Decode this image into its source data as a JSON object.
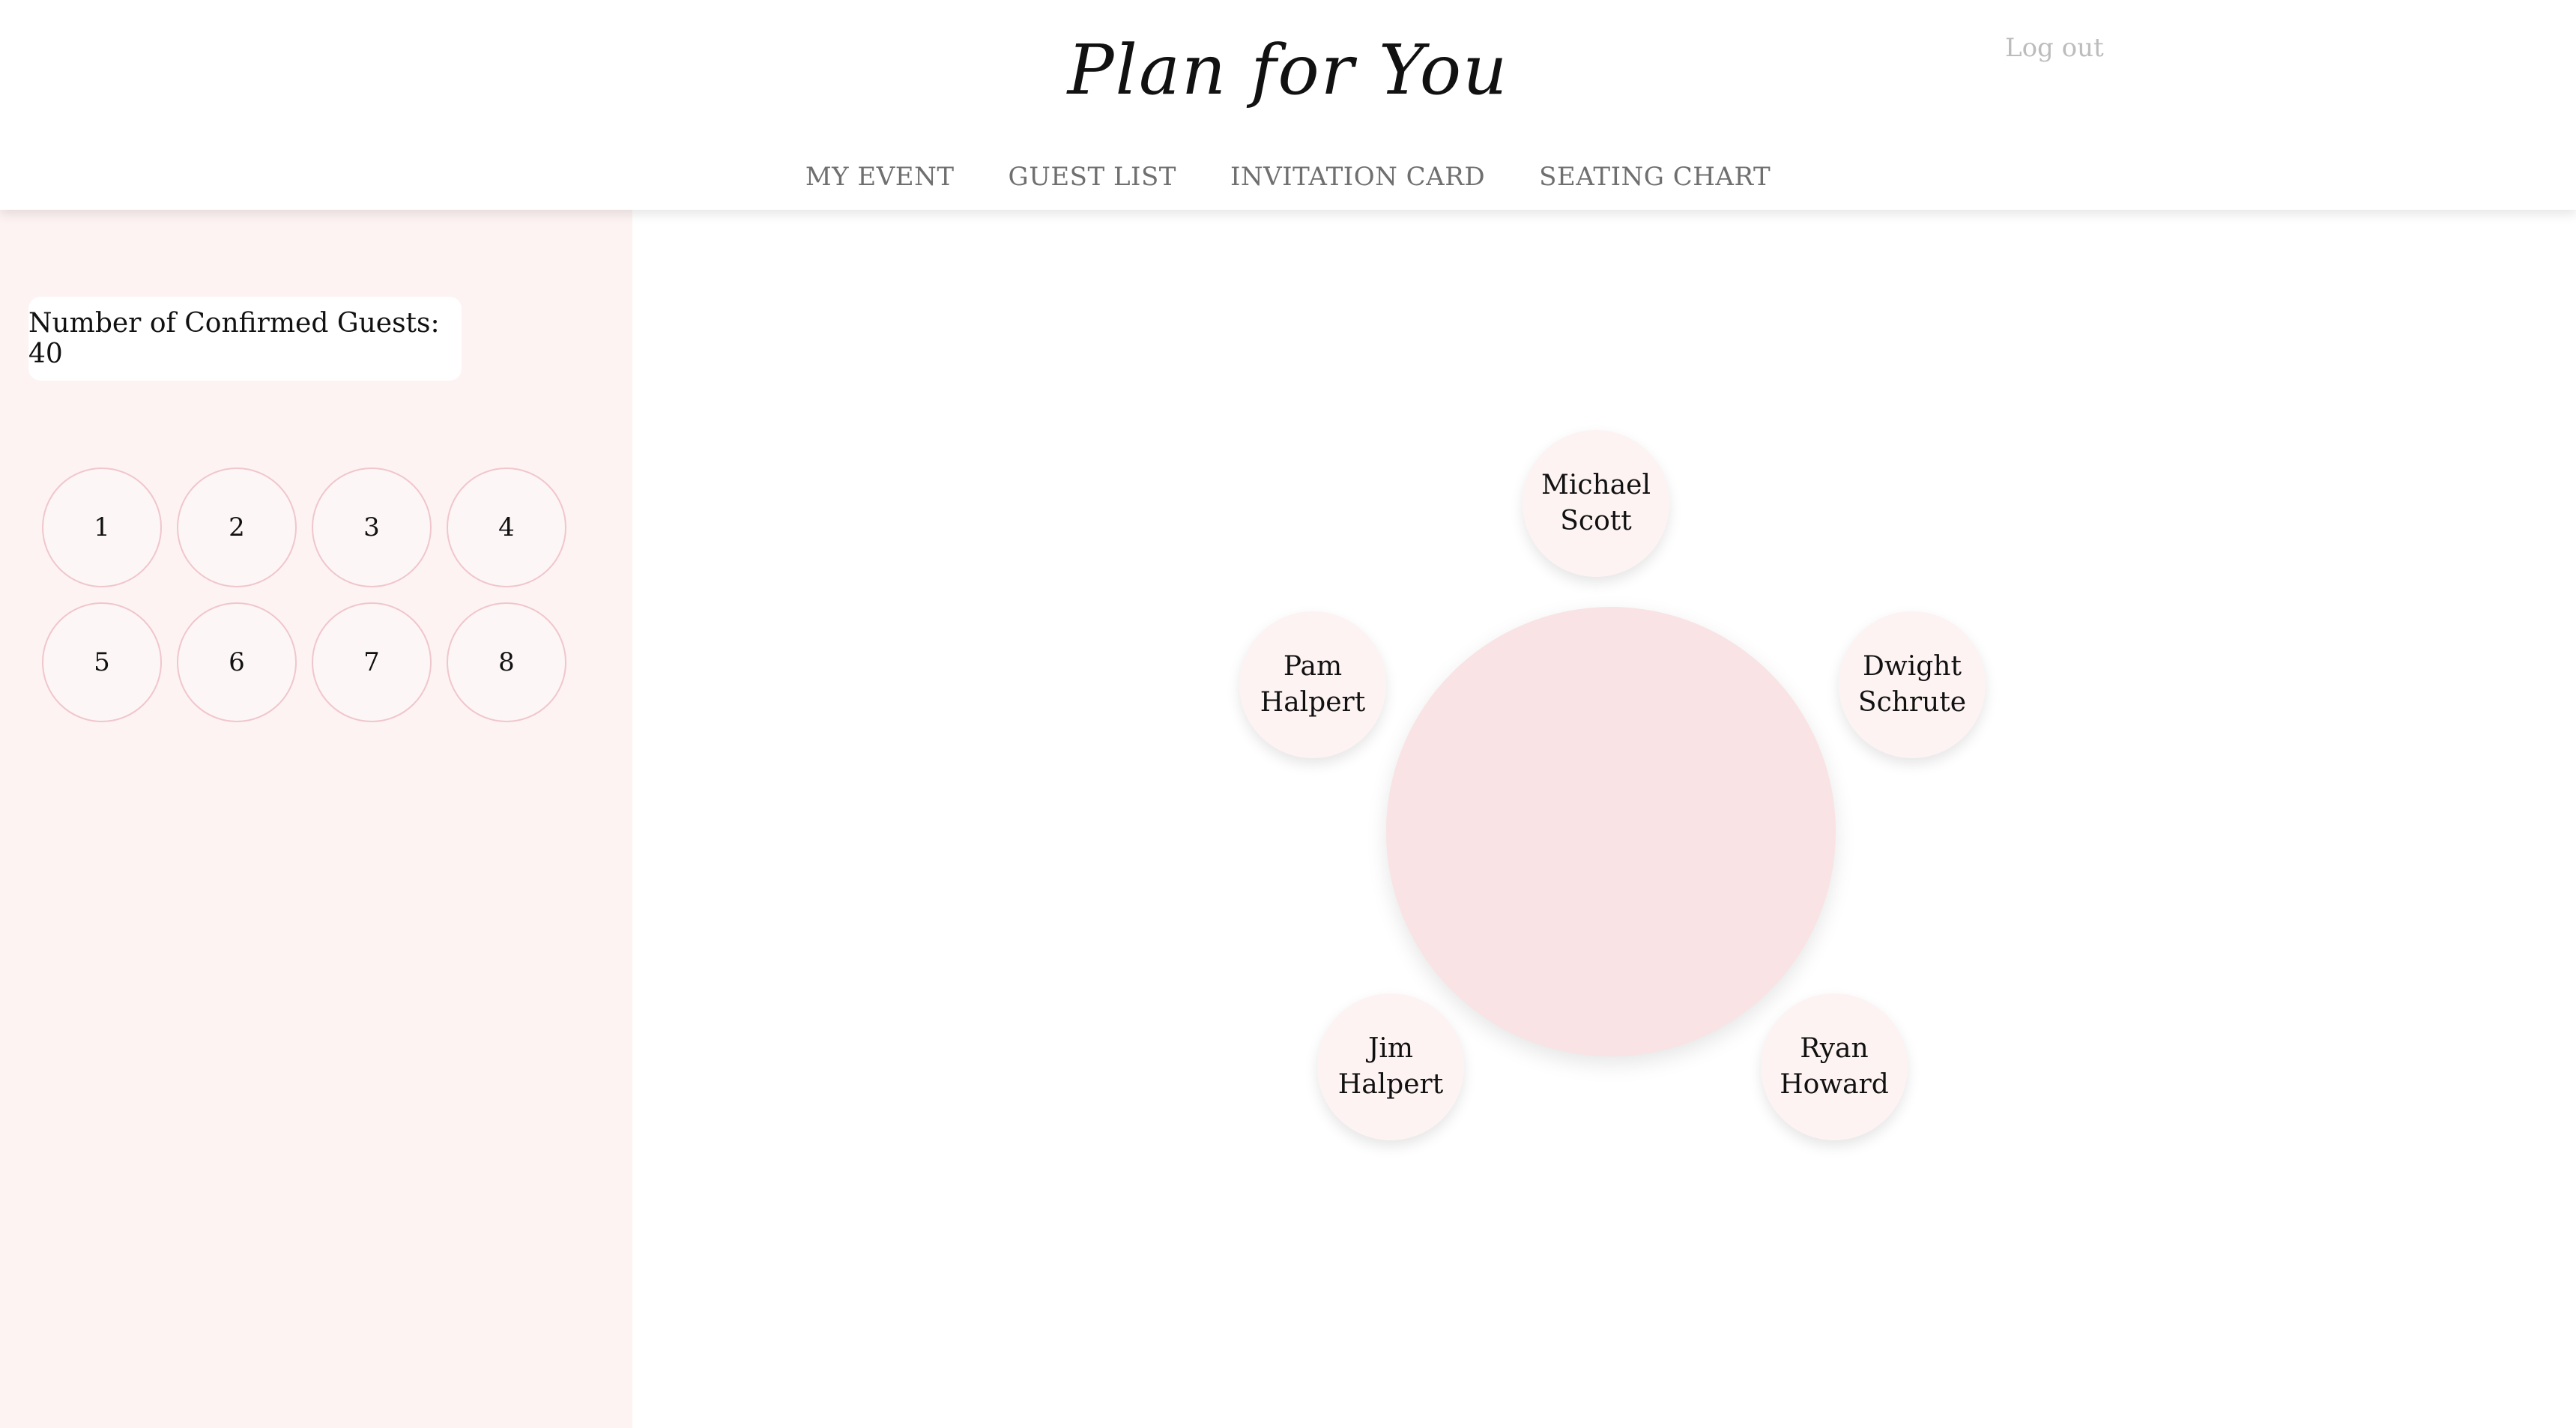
{
  "header": {
    "logo": "Plan for You",
    "logout": "Log out",
    "nav": [
      "MY EVENT",
      "GUEST LIST",
      "INVITATION CARD",
      "SEATING CHART"
    ]
  },
  "sidebar": {
    "guest_count": "Number of Confirmed Guests: 40",
    "tables": [
      "1",
      "2",
      "3",
      "4",
      "5",
      "6",
      "7",
      "8"
    ]
  },
  "seating": {
    "seats": [
      "Michael\nScott",
      "Dwight\nSchrute",
      "Ryan\nHoward",
      "Jim Halpert",
      "Pam Halpert"
    ]
  },
  "colors": {
    "sidebar_bg": "#fdf3f3",
    "table_fill": "#f9e3e4",
    "table_button_border": "#f0c6cc",
    "nav_text": "#6f6f6f",
    "logout_text": "#bcbcbc"
  }
}
